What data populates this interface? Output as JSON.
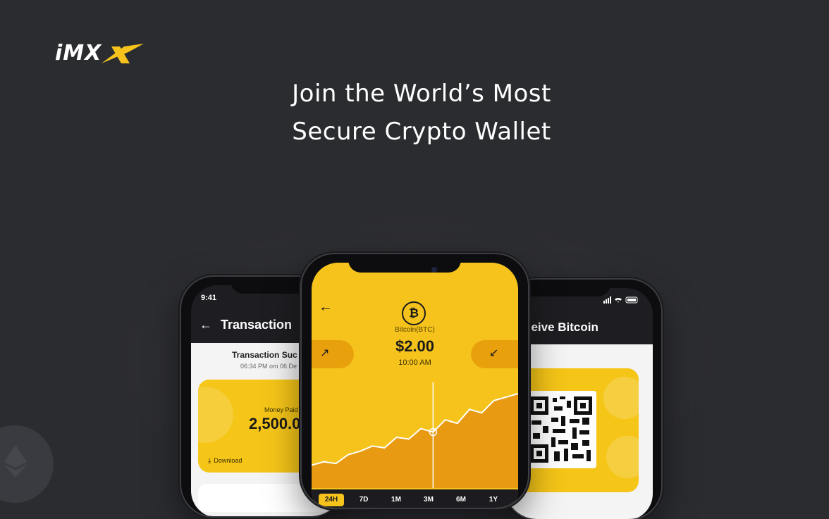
{
  "brand": {
    "logo_text": "iMX"
  },
  "headline": {
    "line1": "Join the World’s Most",
    "line2": "Secure Crypto Wallet"
  },
  "left_phone": {
    "status_time": "9:41",
    "title": "Transaction",
    "status": "Transaction Suc",
    "date": "06:34 PM om 06 De",
    "money_label": "Money Paid",
    "money_value": "2,500.0",
    "download_label": "Download"
  },
  "center_phone": {
    "coin_symbol": "₿",
    "coin_label": "Bitcoin(BTC)",
    "price": "$2.00",
    "time": "10:00 AM",
    "chart_data": {
      "type": "area",
      "y": [
        18,
        22,
        20,
        30,
        34,
        40,
        38,
        50,
        48,
        60,
        56,
        70,
        66,
        82,
        78,
        92,
        96,
        100
      ],
      "highlight_index": 10
    },
    "ranges": [
      {
        "label": "24H",
        "active": true
      },
      {
        "label": "7D",
        "active": false
      },
      {
        "label": "1M",
        "active": false
      },
      {
        "label": "3M",
        "active": false
      },
      {
        "label": "6M",
        "active": false
      },
      {
        "label": "1Y",
        "active": false
      }
    ]
  },
  "right_phone": {
    "title": "ceive Bitcoin"
  },
  "colors": {
    "accent": "#f5c31c",
    "accent_dark": "#e8a10c",
    "background": "#2b2c30"
  }
}
